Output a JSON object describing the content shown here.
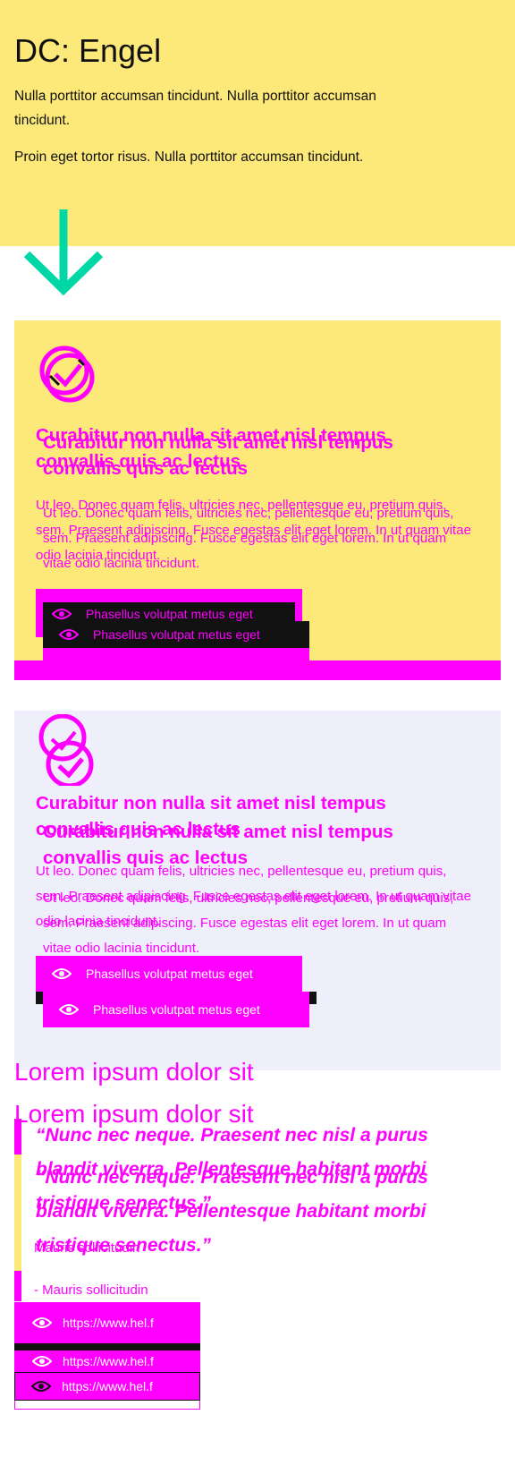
{
  "hero": {
    "title": "DC: Engel",
    "p1": "Nulla porttitor accumsan tincidunt. Nulla porttitor accumsan tincidunt.",
    "p2": "Proin eget tortor risus. Nulla porttitor accumsan tincidunt."
  },
  "cards": [
    {
      "title": "Curabitur non nulla sit amet nisl tempus convallis quis ac lectus",
      "body": "Ut leo. Donec quam felis, ultricies nec, pellentesque eu, pretium quis, sem. Praesent adipiscing. Fusce egestas elit eget lorem. In ut quam vitae odio lacinia tincidunt.",
      "button": "Phasellus volutpat metus eget"
    },
    {
      "title": "Curabitur non nulla sit amet nisl tempus convallis quis ac lectus",
      "body": "Ut leo. Donec quam felis, ultricies nec, pellentesque eu, pretium quis, sem. Praesent adipiscing. Fusce egestas elit eget lorem. In ut quam vitae odio lacinia tincidunt.",
      "button": "Phasellus volutpat metus eget",
      "overlap_text": "convallis quis ac lectus"
    }
  ],
  "section": {
    "title": "Lorem ipsum dolor sit",
    "quote": "“Nunc nec neque. Praesent nec nisl a purus blandit viverra. Pellentesque habitant morbi tristique senectus.”",
    "cite": "Mauris sollicitudin",
    "cite_dash": "- Mauris sollicitudin",
    "link": "https://www.hel.f"
  },
  "colors": {
    "accent": "#ff00ff",
    "yellow": "#fde87a",
    "lavender": "#efeffc",
    "arrow": "#00d7a7"
  },
  "icons": {
    "arrow": "arrow-down-icon",
    "badge": "check-badge-icon",
    "eye": "eye-icon"
  }
}
